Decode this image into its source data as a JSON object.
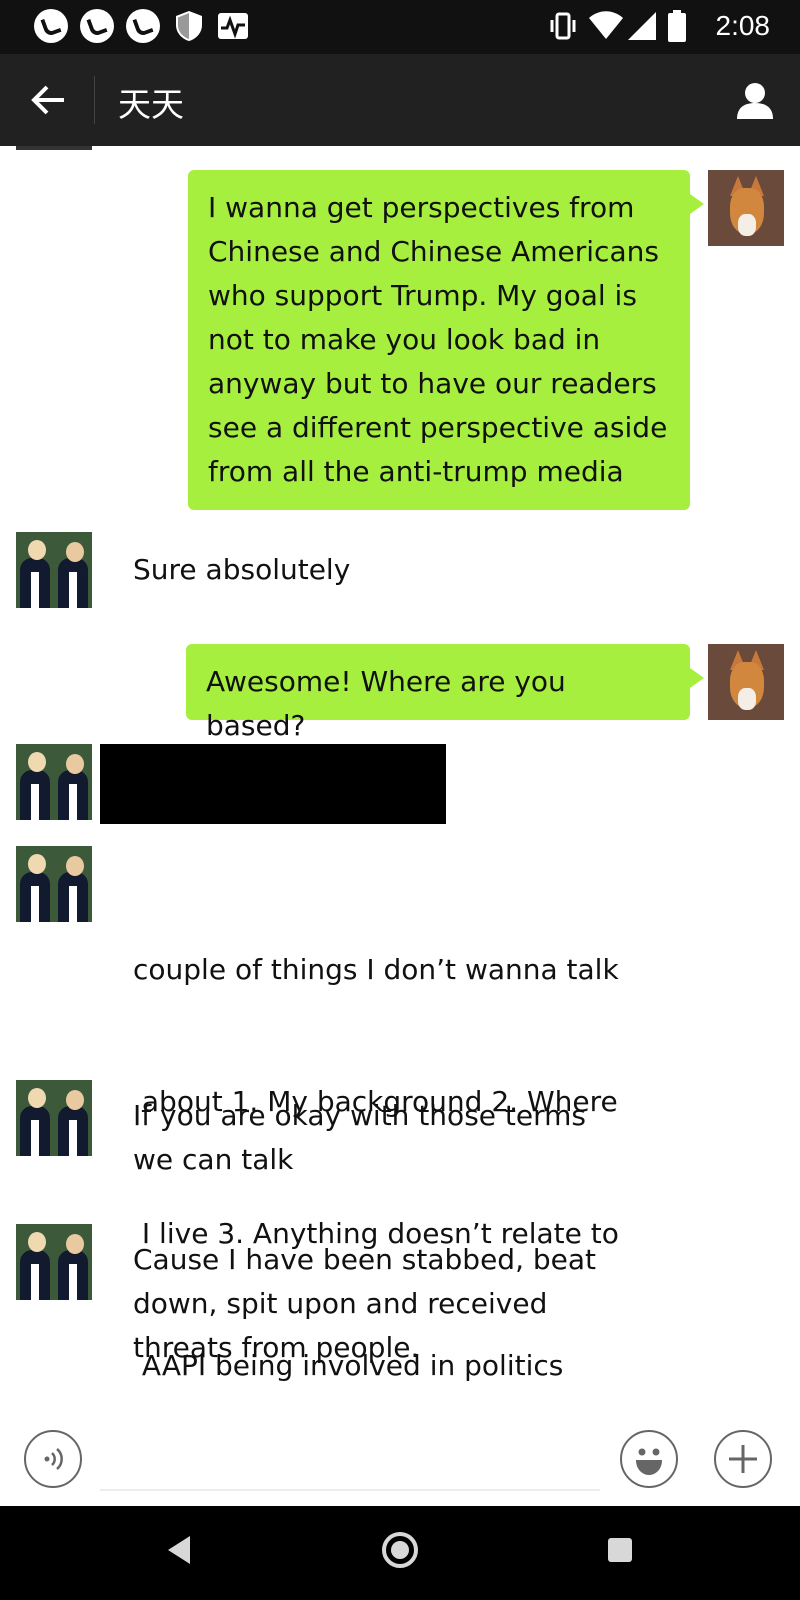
{
  "status_bar": {
    "time": "2:08",
    "left_icons": [
      "notification-icon",
      "notification-icon",
      "notification-icon",
      "shield-icon",
      "activity-icon"
    ],
    "right_icons": [
      "vibrate-icon",
      "wifi-icon",
      "signal-icon",
      "battery-icon"
    ]
  },
  "header": {
    "title": "天天",
    "back_icon": "arrow-left-icon",
    "profile_icon": "person-icon",
    "background": "#212121"
  },
  "messages": [
    {
      "side": "right",
      "sender": "me",
      "lines": [
        "I wanna get perspectives from",
        "Chinese and Chinese Americans",
        "who support Trump. My goal is",
        "not to make you look bad in",
        "anyway but to have our readers",
        "see a different perspective aside",
        "from all the anti-trump media"
      ]
    },
    {
      "side": "left",
      "sender": "other",
      "lines": [
        "Sure absolutely"
      ]
    },
    {
      "side": "right",
      "sender": "me",
      "lines": [
        "Awesome! Where are you based?"
      ]
    },
    {
      "side": "left",
      "sender": "other",
      "redacted": true
    },
    {
      "side": "left",
      "sender": "other",
      "lines": [
        "couple of things I don’t wanna talk",
        " about 1. My background 2. Where",
        " I live 3. Anything doesn’t relate to",
        " AAPI being involved in politics"
      ]
    },
    {
      "side": "left",
      "sender": "other",
      "lines": [
        "If you are okay with those terms",
        "we can talk"
      ]
    },
    {
      "side": "left",
      "sender": "other",
      "lines": [
        "Cause I have been stabbed, beat",
        "down, spit upon and received",
        "threats from people."
      ]
    }
  ],
  "input_bar": {
    "voice_icon": "voice-icon",
    "emoji_icon": "emoji-icon",
    "plus_icon": "plus-icon"
  },
  "colors": {
    "bubble_green": "#a6ef3f",
    "status_bar": "#111111",
    "nav_bar": "#000000"
  }
}
